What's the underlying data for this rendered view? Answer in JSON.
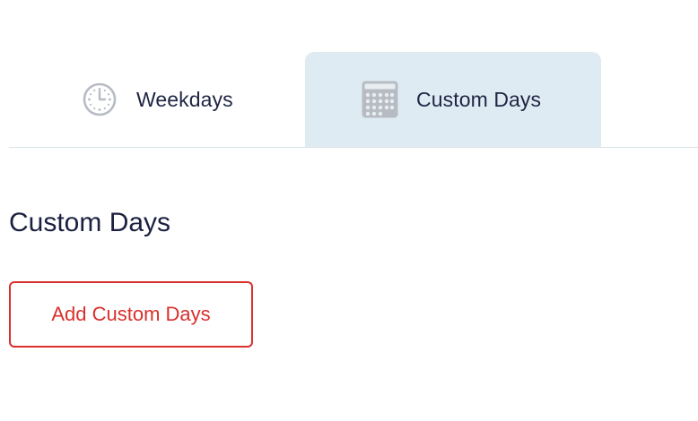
{
  "tabs": [
    {
      "label": "Weekdays",
      "icon": "clock-icon",
      "active": false
    },
    {
      "label": "Custom Days",
      "icon": "calendar-icon",
      "active": true
    }
  ],
  "section": {
    "title": "Custom Days"
  },
  "actions": {
    "add_label": "Add Custom Days"
  },
  "colors": {
    "active_tab_bg": "#dfebf2",
    "accent_red": "#d9302c",
    "text_dark": "#1f2544",
    "icon_gray": "#b7bcc4",
    "divider": "#d9e2e8"
  }
}
